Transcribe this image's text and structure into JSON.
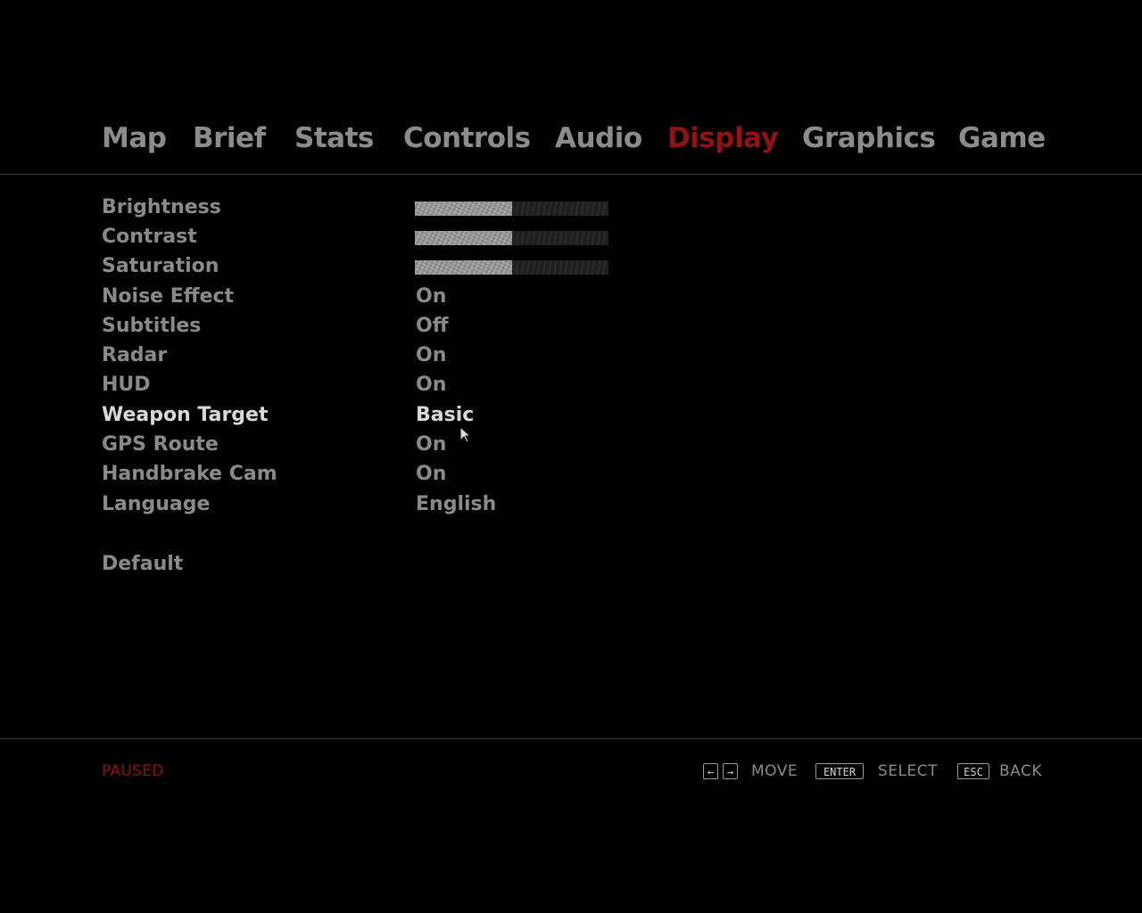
{
  "tabs": [
    {
      "label": "Map"
    },
    {
      "label": "Brief"
    },
    {
      "label": "Stats"
    },
    {
      "label": "Controls"
    },
    {
      "label": "Audio"
    },
    {
      "label": "Display",
      "active": true
    },
    {
      "label": "Graphics"
    },
    {
      "label": "Game"
    }
  ],
  "settings": {
    "brightness": {
      "label": "Brightness",
      "level": 0.5
    },
    "contrast": {
      "label": "Contrast",
      "level": 0.5
    },
    "saturation": {
      "label": "Saturation",
      "level": 0.5
    },
    "noise_effect": {
      "label": "Noise Effect",
      "value": "On"
    },
    "subtitles": {
      "label": "Subtitles",
      "value": "Off"
    },
    "radar": {
      "label": "Radar",
      "value": "On"
    },
    "hud": {
      "label": "HUD",
      "value": "On"
    },
    "weapon_target": {
      "label": "Weapon Target",
      "value": "Basic",
      "selected": true
    },
    "gps_route": {
      "label": "GPS Route",
      "value": "On"
    },
    "handbrake_cam": {
      "label": "Handbrake Cam",
      "value": "On"
    },
    "language": {
      "label": "Language",
      "value": "English"
    }
  },
  "default_label": "Default",
  "footer": {
    "status": "PAUSED",
    "move_key_left": "←",
    "move_key_right": "→",
    "move_label": "MOVE",
    "enter_key": "ENTER",
    "select_label": "SELECT",
    "esc_key": "ESC",
    "back_label": "BACK"
  },
  "colors": {
    "active_tab": "#8e1313",
    "text": "#8a8a8a",
    "selected_text": "#d8d8d8",
    "background": "#000000"
  }
}
